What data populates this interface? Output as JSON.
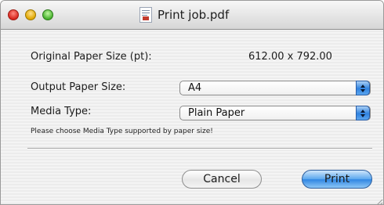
{
  "window": {
    "title": "Print job.pdf"
  },
  "rows": {
    "original_size_label": "Original Paper Size (pt):",
    "original_size_value": "612.00 x 792.00",
    "output_size_label": "Output Paper Size:",
    "output_size_value": "A4",
    "media_type_label": "Media Type:",
    "media_type_value": "Plain Paper"
  },
  "hint": "Please choose Media Type supported by paper size!",
  "buttons": {
    "cancel": "Cancel",
    "print": "Print"
  },
  "icons": {
    "close": "close-icon",
    "minimize": "minimize-icon",
    "zoom": "zoom-icon",
    "document": "pdf-document-icon",
    "stepper": "up-down-arrows-icon",
    "resize": "resize-grip-icon"
  },
  "colors": {
    "accent": "#2f86e3",
    "close": "#d7261d",
    "minimize": "#e0a700",
    "zoom": "#46b12c"
  }
}
